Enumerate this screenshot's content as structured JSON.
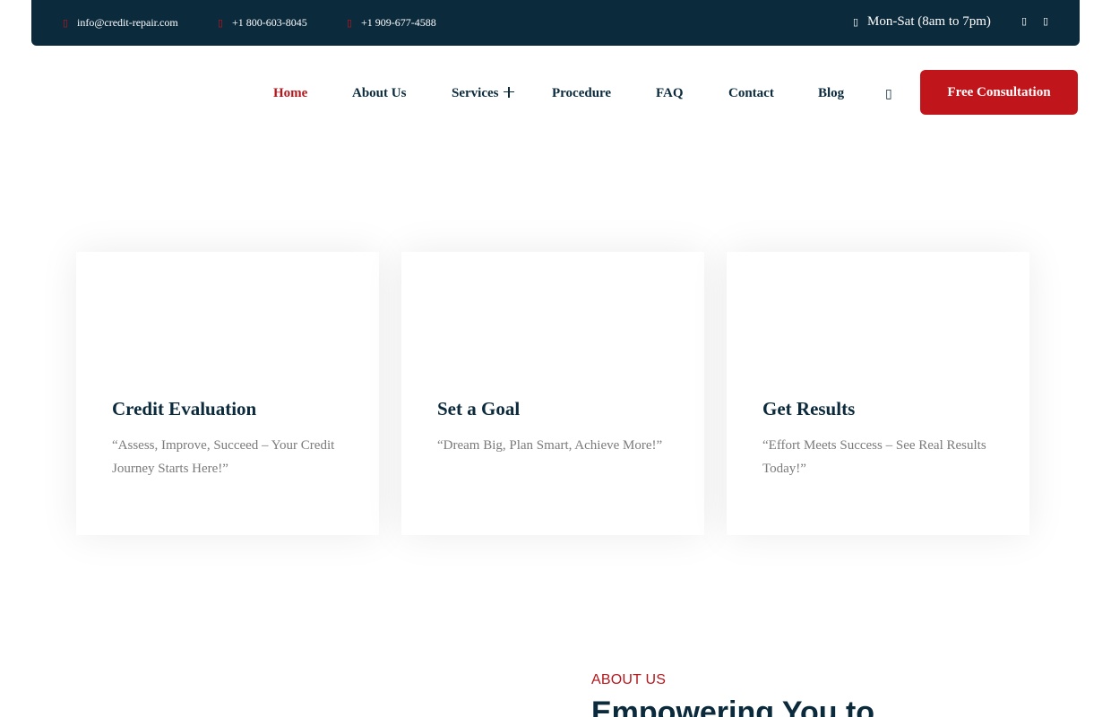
{
  "topbar": {
    "email": "info@credit-repair.com",
    "phone1": "+1 800-603-8045",
    "phone2": "+1 909-677-4588",
    "hours": "Mon-Sat (8am to 7pm)",
    "icons": [
      "envelope-icon",
      "phone-icon",
      "phone-icon",
      "clock-icon",
      "facebook-icon",
      "instagram-icon"
    ]
  },
  "nav": {
    "home": "Home",
    "about": "About Us",
    "services": "Services",
    "procedure": "Procedure",
    "faq": "FAQ",
    "contact": "Contact",
    "blog": "Blog",
    "cta": "Free Consultation"
  },
  "cards": [
    {
      "title": "Credit Evaluation",
      "text": "“Assess, Improve, Succeed – Your Credit Journey Starts Here!”"
    },
    {
      "title": "Set a Goal",
      "text": "“Dream Big, Plan Smart, Achieve More!”"
    },
    {
      "title": "Get Results",
      "text": "“Effort Meets Success – See Real Results Today!”"
    }
  ],
  "about": {
    "label": "ABOUT US",
    "heading": "Empowering You to"
  },
  "colors": {
    "navy": "#0b2a3c",
    "accent": "#c0161b"
  }
}
